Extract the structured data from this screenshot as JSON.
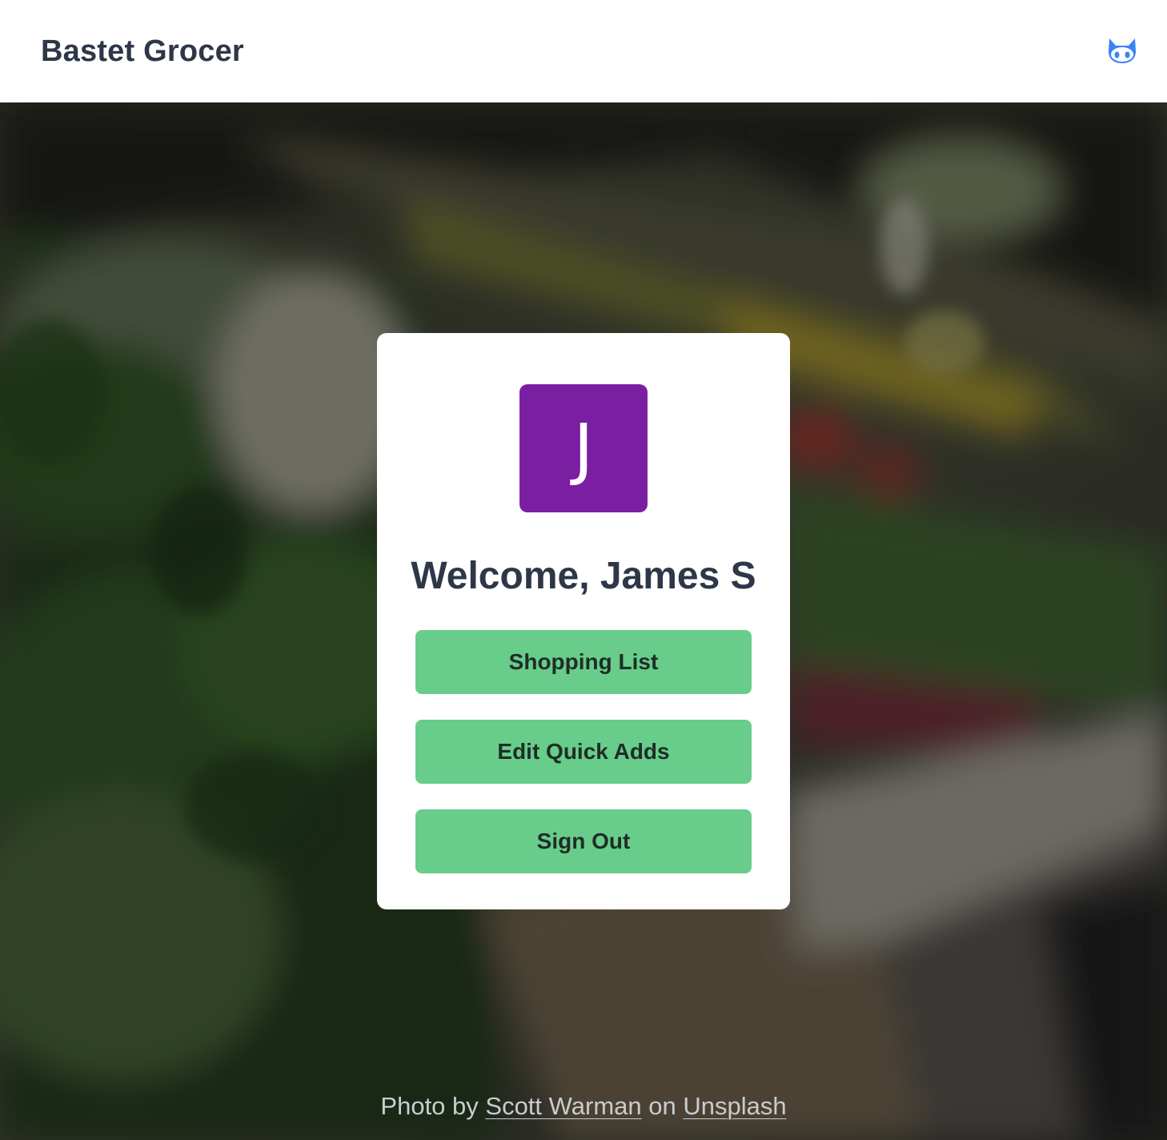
{
  "header": {
    "brand": "Bastet Grocer",
    "github_icon": "github-octocat-icon",
    "accent_color": "#3b82f6"
  },
  "hero": {
    "background_image": "grocery-produce-aisle-photo"
  },
  "card": {
    "avatar_initial": "J",
    "avatar_color": "#7b1fa2",
    "welcome_text": "Welcome, James S",
    "buttons": {
      "shopping_list": "Shopping List",
      "edit_quick_adds": "Edit Quick Adds",
      "sign_out": "Sign Out"
    },
    "button_color": "#68cd8a"
  },
  "credit": {
    "prefix": "Photo by ",
    "author": "Scott Warman",
    "middle": " on ",
    "site": "Unsplash"
  }
}
